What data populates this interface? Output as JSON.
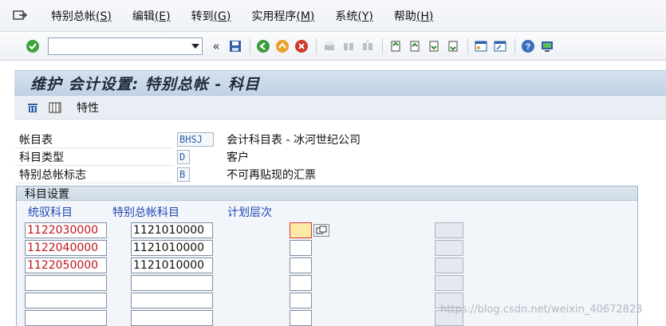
{
  "menubar": {
    "icon": "menu-exit-icon",
    "items": [
      {
        "label": "特别总帐",
        "key": "(S)"
      },
      {
        "label": "编辑",
        "key": "(E)"
      },
      {
        "label": "转到",
        "key": "(G)"
      },
      {
        "label": "实用程序",
        "key": "(M)"
      },
      {
        "label": "系统",
        "key": "(Y)"
      },
      {
        "label": "帮助",
        "key": "(H)"
      }
    ]
  },
  "toolbar": {
    "command_value": "",
    "buttons": [
      "enter-icon",
      "save-icon",
      "back-icon",
      "exit-icon",
      "cancel-icon",
      "print-icon",
      "find-icon",
      "find-next-icon",
      "first-page-icon",
      "prev-page-icon",
      "next-page-icon",
      "last-page-icon",
      "new-session-icon",
      "shortcut-icon",
      "help-icon",
      "layout-icon"
    ],
    "collapse_glyph": "«"
  },
  "title": "维护 会计设置: 特别总帐 - 科目",
  "app_toolbar": {
    "buttons": [
      "delete-icon",
      "table-icon"
    ],
    "label": "特性"
  },
  "header_fields": [
    {
      "label": "帐目表",
      "code": "BHSJ",
      "desc": "会计科目表 - 冰河世纪公司"
    },
    {
      "label": "科目类型",
      "code": "D",
      "desc": "客户"
    },
    {
      "label": "特别总帐标志",
      "code": "B",
      "desc": "不可再贴现的汇票"
    }
  ],
  "group": {
    "title": "科目设置",
    "columns": [
      "统驭科目",
      "特别总帐科目",
      "计划层次"
    ],
    "rows": [
      {
        "recon": "1122030000",
        "sgl": "1121010000",
        "plan": ""
      },
      {
        "recon": "1122040000",
        "sgl": "1121010000",
        "plan": ""
      },
      {
        "recon": "1122050000",
        "sgl": "1121010000",
        "plan": ""
      },
      {
        "recon": "",
        "sgl": "",
        "plan": ""
      },
      {
        "recon": "",
        "sgl": "",
        "plan": ""
      },
      {
        "recon": "",
        "sgl": "",
        "plan": ""
      }
    ]
  },
  "watermark": "https://blog.csdn.net/weixin_40672823",
  "colors": {
    "accent": "#2347b5",
    "red": "#c0141b",
    "focus": "#fbe9a6"
  }
}
